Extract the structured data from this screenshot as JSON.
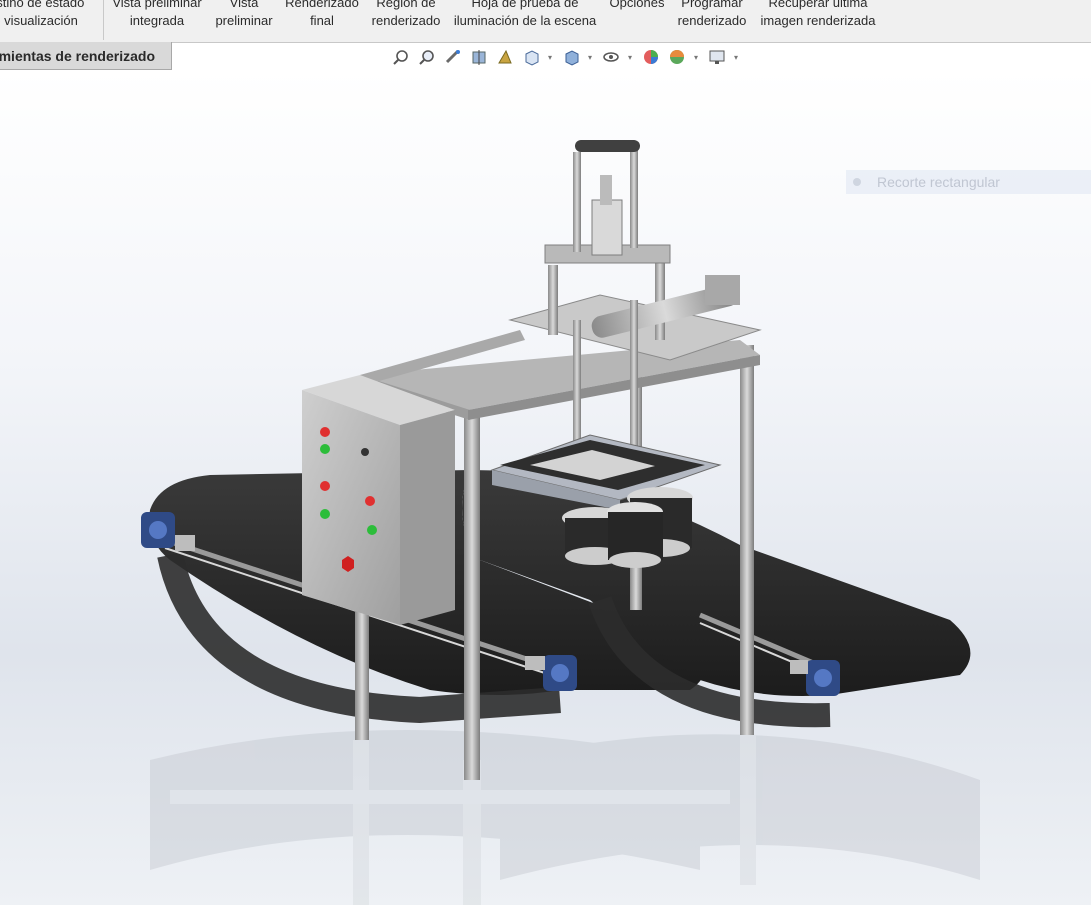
{
  "ribbon": {
    "buttons": [
      {
        "line1": "Destino de estado",
        "line2": "de visualización"
      },
      {
        "line1": "Vista preliminar",
        "line2": "integrada"
      },
      {
        "line1": "Vista",
        "line2": "preliminar"
      },
      {
        "line1": "Renderizado",
        "line2": "final"
      },
      {
        "line1": "Región de",
        "line2": "renderizado"
      },
      {
        "line1": "Hoja de prueba de",
        "line2": "iluminación de la escena"
      },
      {
        "line1": "Opciones",
        "line2": ""
      },
      {
        "line1": "Programar",
        "line2": "renderizado"
      },
      {
        "line1": "Recuperar última",
        "line2": "imagen renderizada"
      }
    ]
  },
  "tab": {
    "label": "Herramientas de renderizado"
  },
  "ghost": {
    "label": "Recorte rectangular"
  },
  "hud": {
    "icons": [
      "zoom-to-fit-icon",
      "zoom-to-area-icon",
      "previous-view-icon",
      "section-view-icon",
      "dynamic-annotation-icon",
      "view-orientation-icon",
      "display-style-icon",
      "hide-show-items-icon",
      "edit-appearance-icon",
      "apply-scene-icon",
      "view-settings-icon"
    ]
  }
}
